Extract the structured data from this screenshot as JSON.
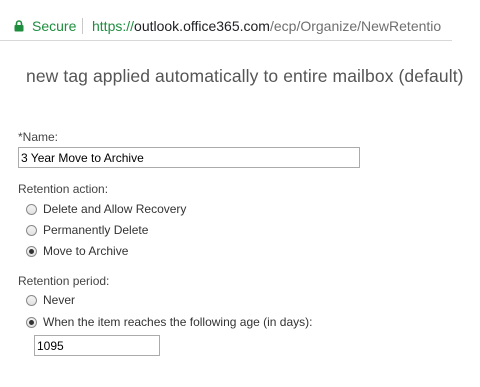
{
  "browser": {
    "secure_label": "Secure",
    "url_scheme": "https://",
    "url_host": "outlook.office365.com",
    "url_path": "/ecp/Organize/NewRetentio"
  },
  "page": {
    "title": "new tag applied automatically to entire mailbox (default)"
  },
  "form": {
    "name_label": "*Name:",
    "name_value": "3 Year Move to Archive",
    "retention_action_label": "Retention action:",
    "retention_actions": [
      {
        "label": "Delete and Allow Recovery",
        "checked": false
      },
      {
        "label": "Permanently Delete",
        "checked": false
      },
      {
        "label": "Move to Archive",
        "checked": true
      }
    ],
    "retention_period_label": "Retention period:",
    "retention_periods": [
      {
        "label": "Never",
        "checked": false
      },
      {
        "label": "When the item reaches the following age (in days):",
        "checked": true
      }
    ],
    "age_days_value": "1095"
  },
  "colors": {
    "secure_green": "#1e8e3e",
    "title_gray": "#555555"
  }
}
